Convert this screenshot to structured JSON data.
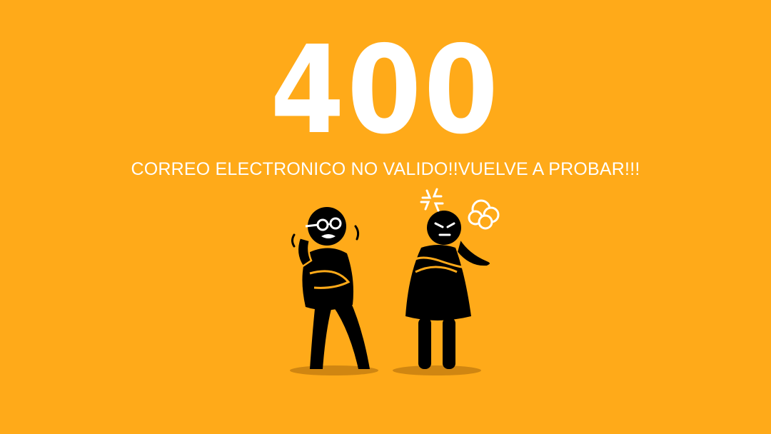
{
  "error": {
    "code": "400",
    "message": "CORREO ELECTRONICO NO VALIDO!!VUELVE A PROBAR!!!"
  },
  "colors": {
    "background": "#FFAA19",
    "text": "#FFFFFF",
    "figure": "#000000",
    "shadow": "#C0790F"
  },
  "illustration": {
    "left_figure": "scared-old-man-icon",
    "right_figure": "angry-woman-icon"
  }
}
